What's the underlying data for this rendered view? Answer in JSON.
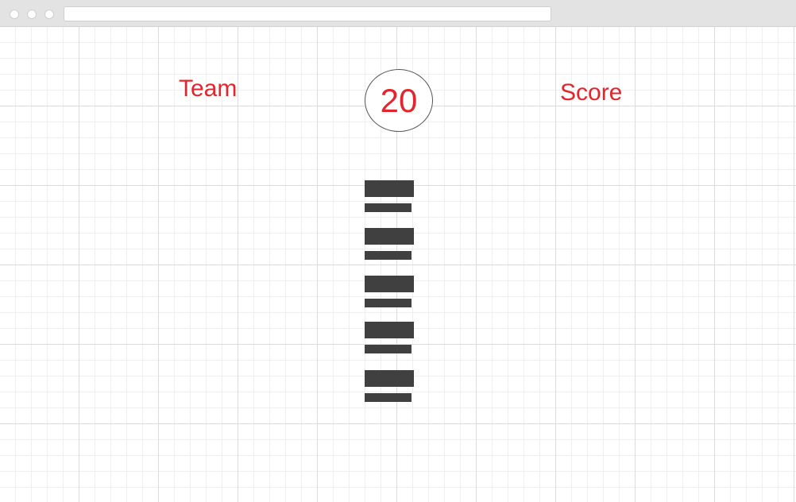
{
  "header": {
    "team_label": "Team",
    "counter_value": "20",
    "score_label": "Score"
  },
  "list": {
    "item_count": 5
  },
  "colors": {
    "label_red": "#e3262d",
    "block_dark": "#404040",
    "grid_line": "#dcdcdc"
  }
}
